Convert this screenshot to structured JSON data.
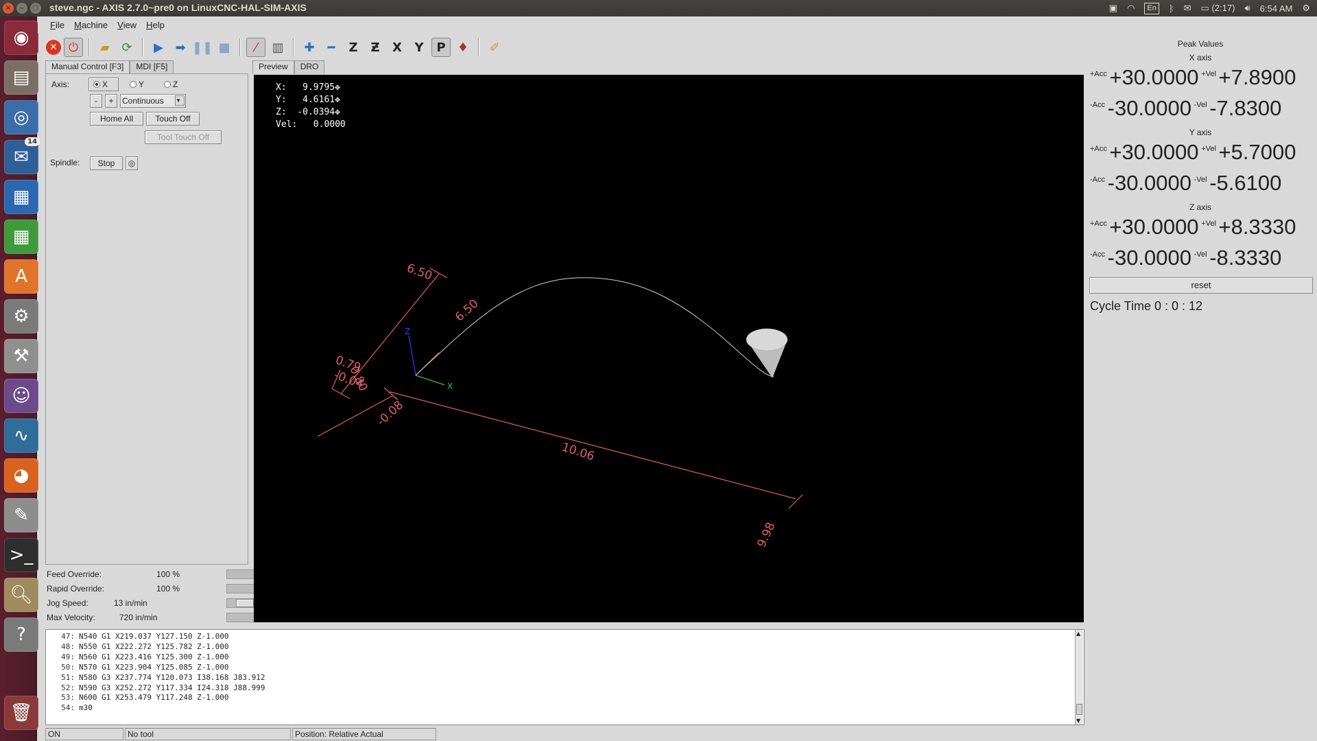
{
  "window": {
    "title": "steve.ngc - AXIS 2.7.0~pre0 on LinuxCNC-HAL-SIM-AXIS"
  },
  "panel": {
    "keyboard": "En",
    "battery": "(2:17)",
    "clock": "6:54 AM"
  },
  "launcher": {
    "badge": "14",
    "icons": [
      "ubuntu-icon",
      "files-icon",
      "chromium-icon",
      "thunderbird-icon",
      "writer-icon",
      "calc-icon",
      "software-center-icon",
      "settings-icon",
      "system-tools-icon",
      "pidgin-icon",
      "system-monitor-icon",
      "firefox-icon",
      "text-editor-icon",
      "terminal-icon",
      "image-viewer-icon",
      "help-icon",
      "trash-icon"
    ]
  },
  "menu": [
    "File",
    "Machine",
    "View",
    "Help"
  ],
  "left_tabs": [
    "Manual Control [F3]",
    "MDI [F5]"
  ],
  "manual": {
    "axis_label": "Axis:",
    "axes": [
      "X",
      "Y",
      "Z"
    ],
    "selected_axis": "X",
    "minus": "-",
    "plus": "+",
    "jog_mode": "Continuous",
    "home_all": "Home All",
    "touch_off": "Touch Off",
    "tool_touch_off": "Tool Touch Off",
    "spindle_label": "Spindle:",
    "spindle_stop": "Stop"
  },
  "overrides": {
    "feed": {
      "label": "Feed Override:",
      "value": "100 %",
      "level": 1.0
    },
    "rapid": {
      "label": "Rapid Override:",
      "value": "100 %",
      "level": 1.0
    },
    "jog": {
      "label": "Jog Speed:",
      "value": "13 in/min",
      "level": 0.18
    },
    "maxvel": {
      "label": "Max Velocity:",
      "value": "720 in/min",
      "level": 1.0
    }
  },
  "preview_tabs": [
    "Preview",
    "DRO"
  ],
  "dro": {
    "x": "X:   9.9795",
    "y": "Y:   4.6161",
    "z": "Z:  -0.0394",
    "vel": "Vel:   0.0000"
  },
  "dimensions": {
    "top_extent": "6.50",
    "y_extent": "6.50",
    "z_max": "0.79",
    "z_overlap": "0.80",
    "z_min": "-0.04",
    "x_min": "-0.08",
    "x_length": "10.06",
    "x_max": "9.98"
  },
  "axes_labels": {
    "z": "Z",
    "x": "X"
  },
  "peak": {
    "title": "Peak Values",
    "acc_plus": "+Acc",
    "acc_minus": "-Acc",
    "vel_plus": "+Vel",
    "vel_minus": "-Vel",
    "x": {
      "label": "X axis",
      "acc_p": "+30.0000",
      "vel_p": "+7.8900",
      "acc_m": "-30.0000",
      "vel_m": "-7.8300"
    },
    "y": {
      "label": "Y axis",
      "acc_p": "+30.0000",
      "vel_p": "+5.7000",
      "acc_m": "-30.0000",
      "vel_m": "-5.6100"
    },
    "z": {
      "label": "Z axis",
      "acc_p": "+30.0000",
      "vel_p": "+8.3330",
      "acc_m": "-30.0000",
      "vel_m": "-8.3330"
    },
    "reset": "reset",
    "cycle_time": "Cycle Time  0 :  0 : 12"
  },
  "gcode": [
    {
      "n": "47:",
      "code": "N540 G1 X219.037 Y127.150 Z-1.000"
    },
    {
      "n": "48:",
      "code": "N550 G1 X222.272 Y125.782 Z-1.000"
    },
    {
      "n": "49:",
      "code": "N560 G1 X223.416 Y125.300 Z-1.000"
    },
    {
      "n": "50:",
      "code": "N570 G1 X223.904 Y125.085 Z-1.000"
    },
    {
      "n": "51:",
      "code": "N580 G3 X237.774 Y120.073 I38.168 J83.912"
    },
    {
      "n": "52:",
      "code": "N590 G3 X252.272 Y117.334 I24.318 J88.999"
    },
    {
      "n": "53:",
      "code": "N600 G1 X253.479 Y117.248 Z-1.000"
    },
    {
      "n": "54:",
      "code": "m30"
    }
  ],
  "status": {
    "state": "ON",
    "tool": "No tool",
    "position": "Position: Relative Actual"
  },
  "colors": {
    "dimension": "#e06060",
    "toolpath": "#d0d0d0",
    "preview_bg": "#000000",
    "launcher": "#4a1a27"
  }
}
